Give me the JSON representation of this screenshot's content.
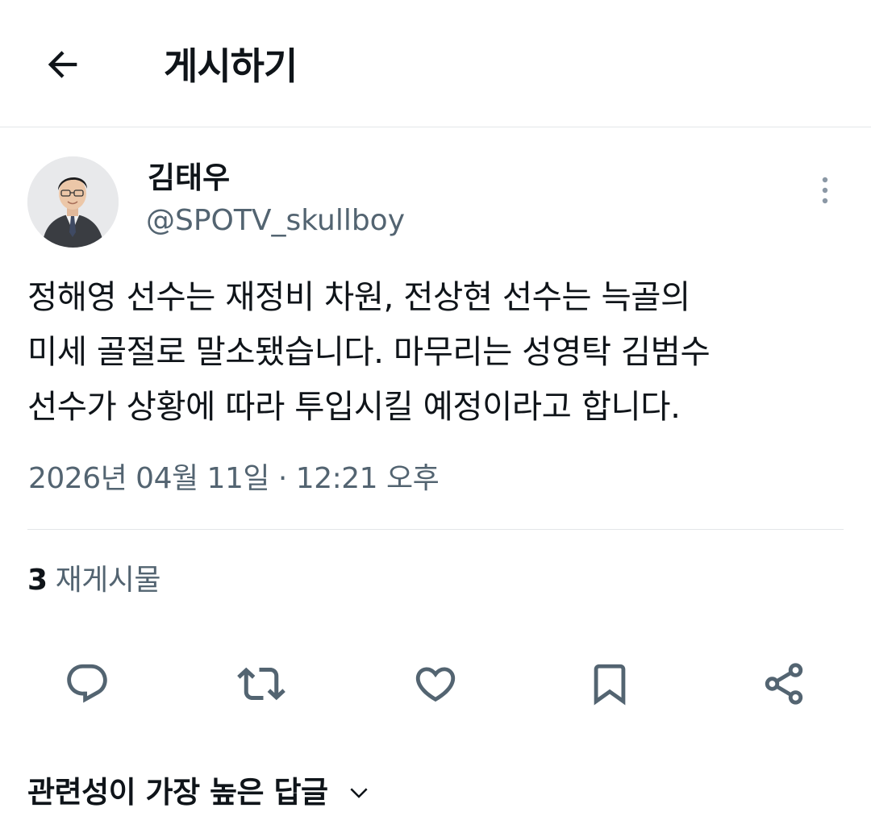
{
  "header": {
    "back_icon": "arrow-left-icon",
    "title": "게시하기"
  },
  "post": {
    "author_name": "김태우",
    "author_handle": "@SPOTV_skullboy",
    "avatar_icon": "profile-photo",
    "more_icon": "more-vertical-icon",
    "text_lines": [
      "정해영 선수는 재정비 차원, 전상현 선수는 늑골의",
      "미세 골절로 말소됐습니다. 마무리는 성영탁 김범수",
      "선수가 상황에 따라 투입시킬 예정이라고 합니다."
    ],
    "timestamp": "2026년 04월 11일 · 12:21 오후",
    "repost_count": "3",
    "repost_label": "재게시물"
  },
  "actions": [
    {
      "icon": "reply-icon"
    },
    {
      "icon": "repost-icon"
    },
    {
      "icon": "like-icon"
    },
    {
      "icon": "bookmark-icon"
    },
    {
      "icon": "share-icon"
    }
  ],
  "replies": {
    "sort_label": "관련성이 가장 높은 답글",
    "chevron_icon": "chevron-down-icon"
  },
  "colors": {
    "text_primary": "#0f1419",
    "text_secondary": "#536471",
    "icon_gray": "#536471",
    "divider": "#e3e6e8"
  }
}
